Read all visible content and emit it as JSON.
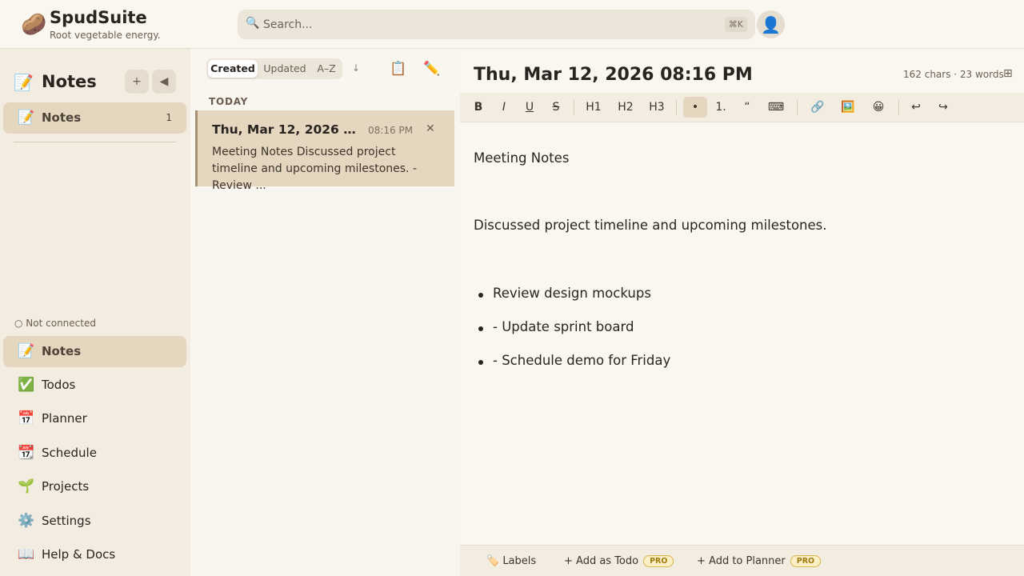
{
  "brand": {
    "logo_icon": "potato",
    "logo_glyph": "🥔",
    "name": "SpudSuite",
    "tagline": "Root vegetable energy."
  },
  "search": {
    "placeholder": "Search...",
    "shortcut": "⌘K",
    "icon": "🔍"
  },
  "user": {
    "avatar_glyph": "👤"
  },
  "sidebar": {
    "header": {
      "icon": "📝",
      "title": "Notes",
      "add_glyph": "+",
      "collapse_glyph": "◀"
    },
    "active_section": {
      "icon": "📝",
      "label": "Notes",
      "count": "1"
    },
    "connection_status": "○ Not connected",
    "nav": [
      {
        "icon": "📝",
        "label": "Notes",
        "active": true
      },
      {
        "icon": "✅",
        "label": "Todos",
        "active": false
      },
      {
        "icon": "📅",
        "label": "Planner",
        "active": false
      },
      {
        "icon": "📆",
        "label": "Schedule",
        "active": false
      },
      {
        "icon": "🌱",
        "label": "Projects",
        "active": false
      },
      {
        "icon": "⚙️",
        "label": "Settings",
        "active": false
      },
      {
        "icon": "📖",
        "label": "Help & Docs",
        "active": false
      }
    ]
  },
  "note_list": {
    "sort_tabs": [
      "Created",
      "Updated",
      "A–Z"
    ],
    "active_sort": "Created",
    "sort_direction_glyph": "↓",
    "clipboard_icon": "📋",
    "new_note_icon": "✏️",
    "group_label": "TODAY",
    "notes": [
      {
        "title": "Thu, Mar 12, 2026 08:16 PM",
        "time": "08:16 PM",
        "close_glyph": "✕",
        "preview": "Meeting Notes Discussed project timeline and upcoming milestones. -   Review ..."
      }
    ]
  },
  "editor": {
    "title": "Thu, Mar 12, 2026 08:16 PM",
    "stats": "162 chars · 23 words",
    "layout_icon": "⊞",
    "toolbar": {
      "bold": "B",
      "italic": "I",
      "underline": "U",
      "strike": "S",
      "h1": "H1",
      "h2": "H2",
      "h3": "H3",
      "bullet_list": "•",
      "ordered_list": "1.",
      "quote": "“",
      "code": "⌨",
      "link": "🔗",
      "image": "🖼️",
      "emoji": "😀",
      "undo": "↩",
      "redo": "↪"
    },
    "content": {
      "heading_line": "Meeting Notes",
      "paragraph": "Discussed project timeline and upcoming milestones.",
      "bullets": [
        "Review design mockups",
        "- Update sprint board",
        "- Schedule demo for Friday"
      ]
    },
    "footer": {
      "labels_button": "🏷️ Labels",
      "add_todo_button": "+ Add as Todo",
      "add_planner_button": "+ Add to Planner",
      "pro_badge": "PRO"
    }
  },
  "colors": {
    "accent": "#e4d6bf",
    "background": "#f9f6f0",
    "pro_badge": "#d9b44a"
  }
}
